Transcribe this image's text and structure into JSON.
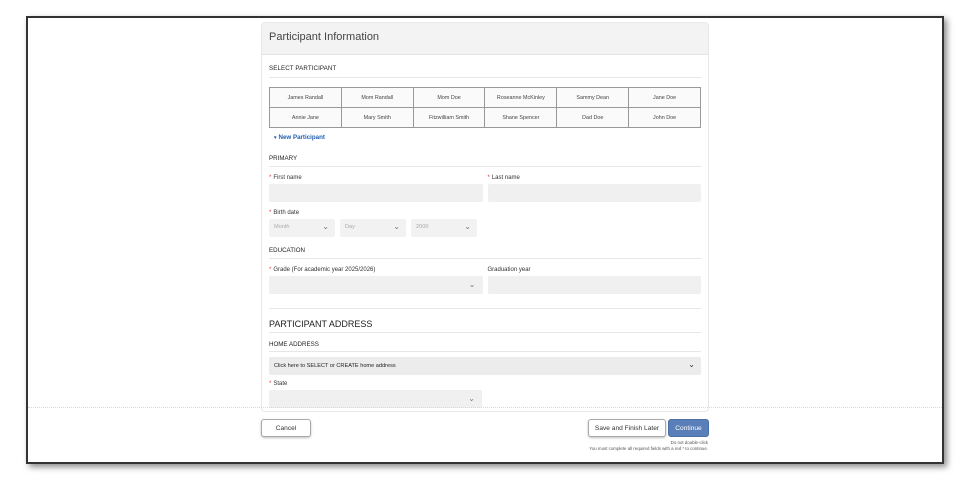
{
  "card": {
    "title": "Participant Information"
  },
  "select_participant": {
    "label": "SELECT PARTICIPANT",
    "rows": [
      [
        "James Randall",
        "Mom Randall",
        "Mom Doe",
        "Roseanne McKinley",
        "Sammy Dean",
        "Jane Doe"
      ],
      [
        "Annie Jane",
        "Mary Smith",
        "Fitzwilliam Smith",
        "Shane Spencer",
        "Dad Doe",
        "John Doe"
      ]
    ],
    "new_participant": "New Participant"
  },
  "primary": {
    "heading": "PRIMARY",
    "first_name_label": "First name",
    "last_name_label": "Last name",
    "birth_date_label": "Birth date",
    "month_placeholder": "Month",
    "day_placeholder": "Day",
    "year_placeholder": "2000"
  },
  "education": {
    "heading": "EDUCATION",
    "grade_label": "Grade (For academic year 2025/2026)",
    "graduation_label": "Graduation year"
  },
  "address": {
    "title": "PARTICIPANT ADDRESS",
    "home_label": "HOME ADDRESS",
    "select_text": "Click here to SELECT or CREATE home address",
    "state_label": "State"
  },
  "footer": {
    "cancel": "Cancel",
    "save": "Save and Finish Later",
    "continue": "Continue",
    "note1": "Do not double-click",
    "note2": "You must complete all required fields with a red * to continue."
  },
  "colors": {
    "accent": "#5a7fb8",
    "link": "#1f5fb0",
    "required": "#d33333"
  },
  "icons": {
    "chevron": "chevron-down-icon",
    "caret": "caret-down-icon"
  }
}
